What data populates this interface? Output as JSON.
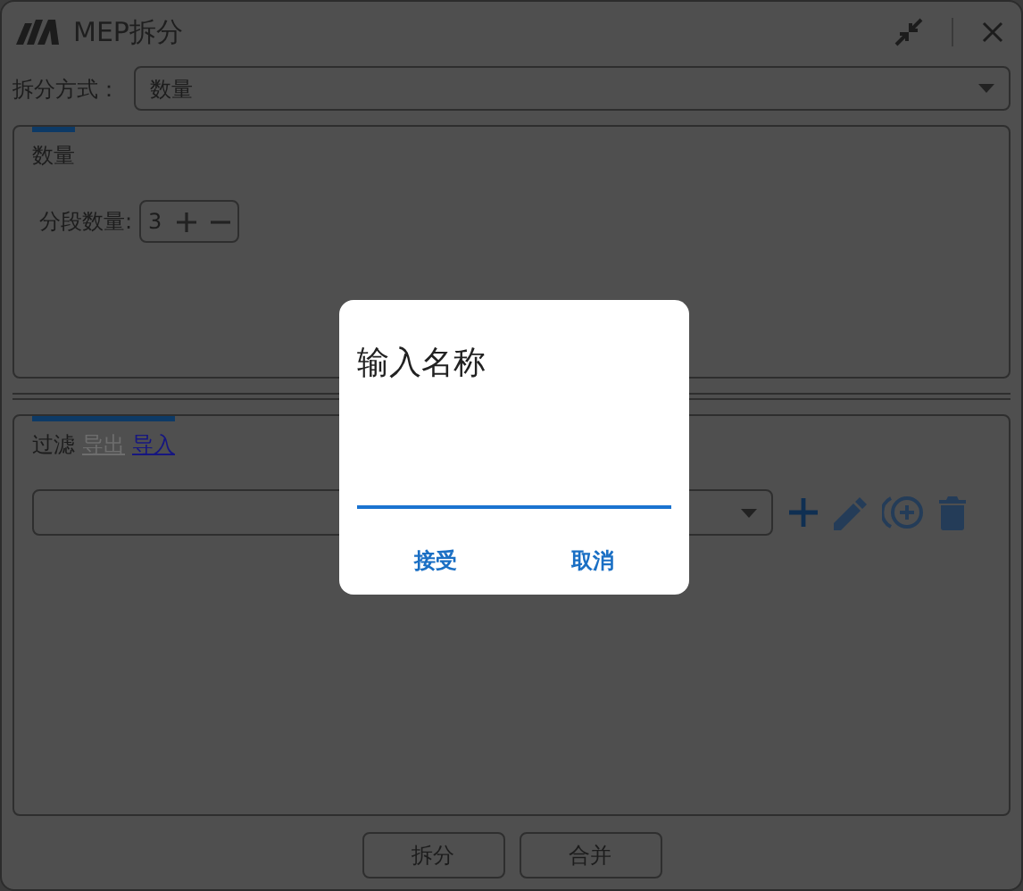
{
  "window": {
    "title": "MEP拆分"
  },
  "split_mode": {
    "label": "拆分方式：",
    "value": "数量"
  },
  "quantity_panel": {
    "tabs": [
      {
        "label": "数量",
        "selected": true
      }
    ],
    "segment_label": "分段数量:",
    "segment_value": "3"
  },
  "filter_panel": {
    "tabs": [
      {
        "label": "过滤",
        "kind": "plain"
      },
      {
        "label": "导出",
        "kind": "disabled"
      },
      {
        "label": "导入",
        "kind": "link"
      }
    ]
  },
  "buttons": [
    "拆分",
    "合并"
  ],
  "dialog": {
    "title": "输入名称",
    "buttons": [
      "接受",
      "取消"
    ]
  }
}
